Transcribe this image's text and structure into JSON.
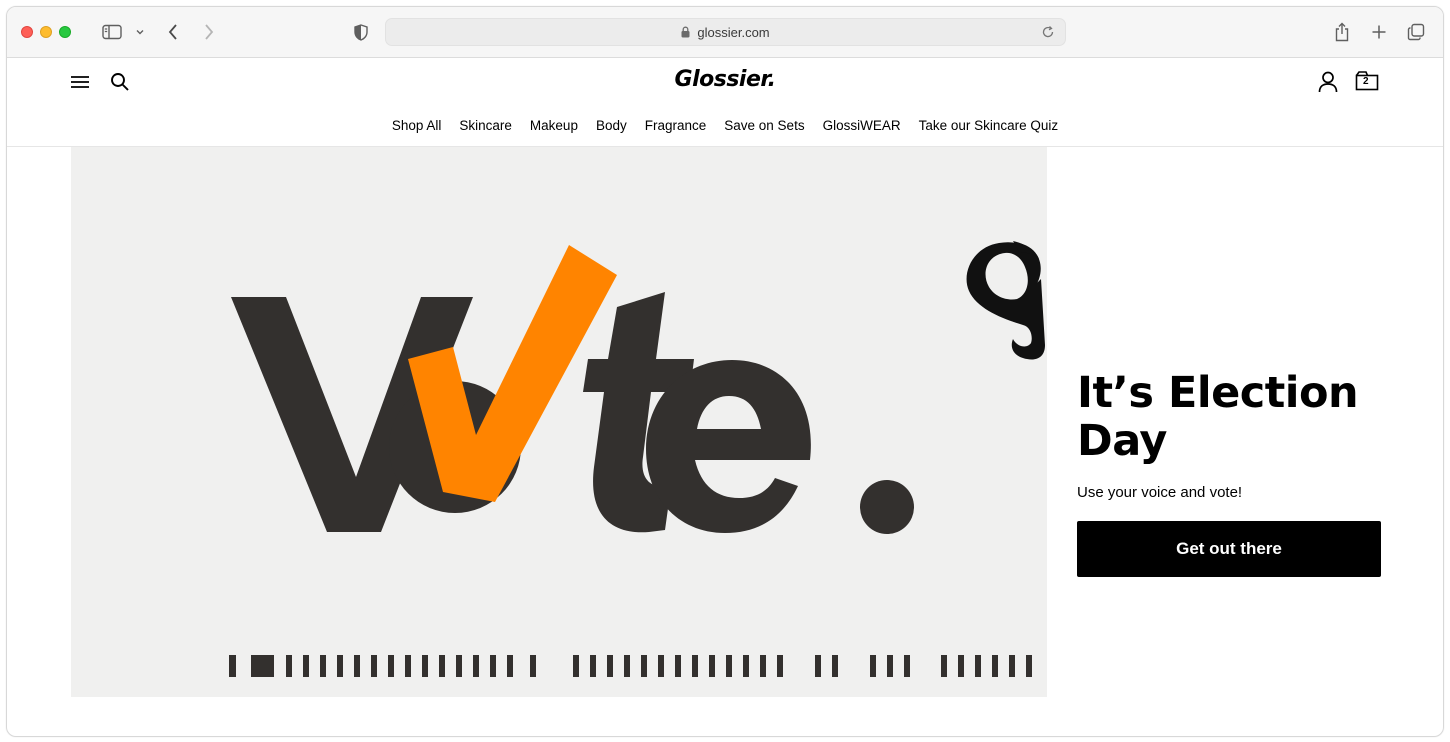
{
  "browser": {
    "url": "glossier.com",
    "icons": [
      "sidebar-icon",
      "chevron-down-icon",
      "back-icon",
      "forward-icon",
      "privacy-shield-icon",
      "lock-icon",
      "reload-icon",
      "share-icon",
      "new-tab-icon",
      "tabs-overview-icon"
    ]
  },
  "header": {
    "logo": "Glossier.",
    "cart_count": "2",
    "icons": [
      "menu-icon",
      "search-icon",
      "account-icon",
      "bag-icon"
    ]
  },
  "nav": {
    "items": [
      {
        "label": "Shop All"
      },
      {
        "label": "Skincare"
      },
      {
        "label": "Makeup"
      },
      {
        "label": "Body"
      },
      {
        "label": "Fragrance"
      },
      {
        "label": "Save on Sets"
      },
      {
        "label": "GlossiWEAR"
      },
      {
        "label": "Take our Skincare Quiz"
      }
    ]
  },
  "hero": {
    "word": "Vote.",
    "colors": {
      "background": "#f0f0ef",
      "ink": "#33302e",
      "check": "#ff8400"
    }
  },
  "promo": {
    "headline": "It’s Election Day",
    "subtext": "Use your voice and vote!",
    "button_label": "Get out there"
  }
}
